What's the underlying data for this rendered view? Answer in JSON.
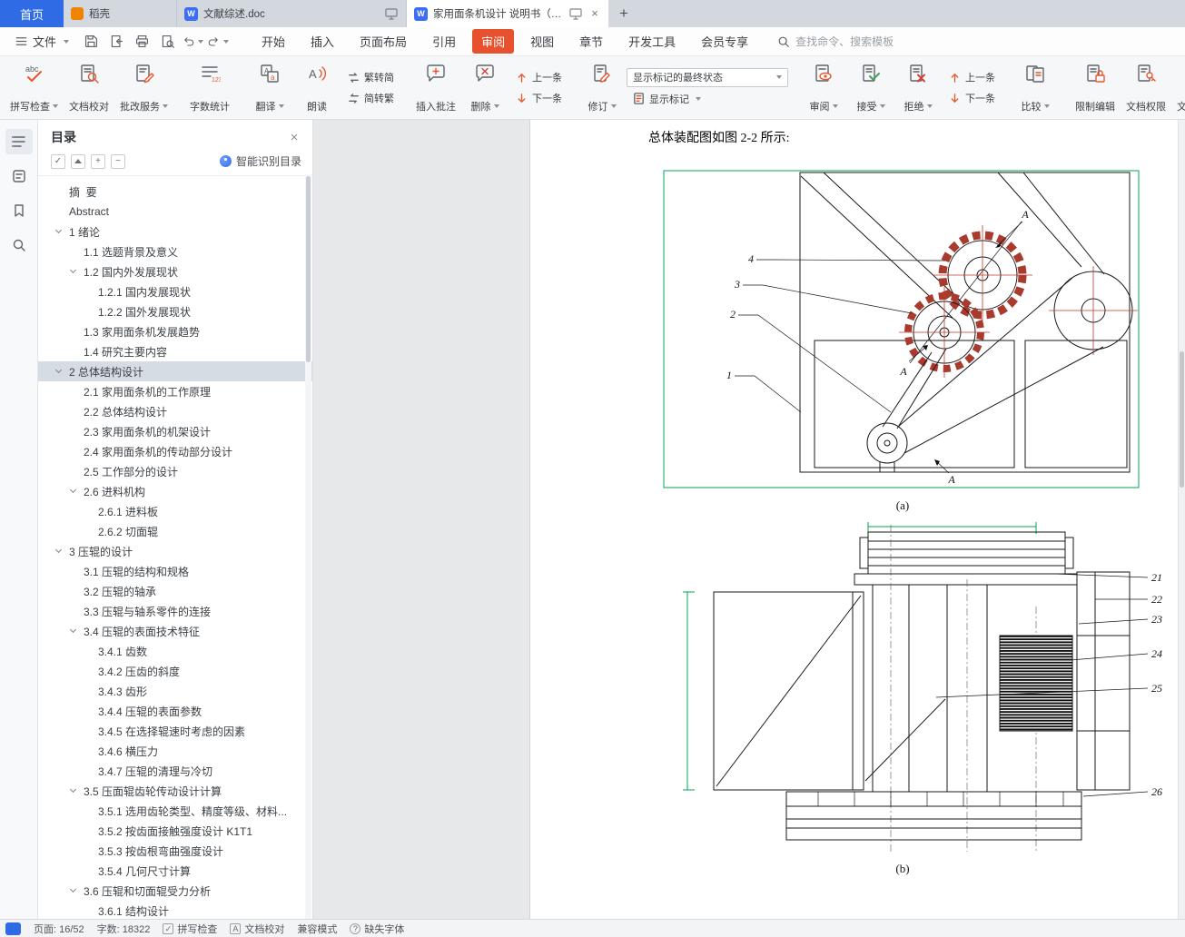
{
  "tabbar": {
    "home": "首页",
    "docer": "稻壳",
    "doc1": "文献综述.doc",
    "doc2": "家用面条机设计 说明书（论文）",
    "close": "×",
    "new_tab": "+"
  },
  "menubar": {
    "file": "文件",
    "items": [
      {
        "label": "开始"
      },
      {
        "label": "插入"
      },
      {
        "label": "页面布局"
      },
      {
        "label": "引用"
      },
      {
        "label": "审阅",
        "active": true
      },
      {
        "label": "视图"
      },
      {
        "label": "章节"
      },
      {
        "label": "开发工具"
      },
      {
        "label": "会员专享"
      }
    ],
    "search_placeholder": "查找命令、搜索模板"
  },
  "ribbon": {
    "spellcheck": "拼写检查",
    "proofread": "文档校对",
    "correction": "批改服务",
    "wordcount": "字数统计",
    "translate": "翻译",
    "readaloud": "朗读",
    "trad_to_simp": "繁转简",
    "simp_to_trad": "简转繁",
    "insert_comment": "插入批注",
    "delete_comment": "删除",
    "prev_comment": "上一条",
    "next_comment": "下一条",
    "track_changes": "修订",
    "markup_state": "显示标记的最终状态",
    "show_markup": "显示标记",
    "review": "审阅",
    "accept": "接受",
    "reject": "拒绝",
    "prev_change": "上一条",
    "next_change": "下一条",
    "compare": "比较",
    "restrict_edit": "限制编辑",
    "doc_permission": "文档权限",
    "doc_auth": "文档认证"
  },
  "toc": {
    "title": "目录",
    "close": "×",
    "smart_recognize": "智能识别目录",
    "items": [
      {
        "label": "摘  要",
        "level": 1
      },
      {
        "label": "Abstract",
        "level": 1
      },
      {
        "label": "1 绪论",
        "level": 1,
        "arrow": true
      },
      {
        "label": "1.1 选题背景及意义",
        "level": 2
      },
      {
        "label": "1.2 国内外发展现状",
        "level": 2,
        "arrow": true
      },
      {
        "label": "1.2.1 国内发展现状",
        "level": 3
      },
      {
        "label": "1.2.2 国外发展现状",
        "level": 3
      },
      {
        "label": "1.3 家用面条机发展趋势",
        "level": 2
      },
      {
        "label": "1.4 研究主要内容",
        "level": 2
      },
      {
        "label": "2 总体结构设计",
        "level": 1,
        "arrow": true,
        "selected": true
      },
      {
        "label": "2.1 家用面条机的工作原理",
        "level": 2
      },
      {
        "label": "2.2 总体结构设计",
        "level": 2
      },
      {
        "label": "2.3 家用面条机的机架设计",
        "level": 2
      },
      {
        "label": "2.4 家用面条机的传动部分设计",
        "level": 2
      },
      {
        "label": "2.5 工作部分的设计",
        "level": 2
      },
      {
        "label": "2.6 进料机构",
        "level": 2,
        "arrow": true
      },
      {
        "label": "2.6.1 进料板",
        "level": 3
      },
      {
        "label": "2.6.2 切面辊",
        "level": 3
      },
      {
        "label": "3 压辊的设计",
        "level": 1,
        "arrow": true
      },
      {
        "label": "3.1 压辊的结构和规格",
        "level": 2
      },
      {
        "label": "3.2 压辊的轴承",
        "level": 2
      },
      {
        "label": "3.3 压辊与轴系零件的连接",
        "level": 2
      },
      {
        "label": "3.4 压辊的表面技术特征",
        "level": 2,
        "arrow": true
      },
      {
        "label": "3.4.1 齿数",
        "level": 3
      },
      {
        "label": "3.4.2 压齿的斜度",
        "level": 3
      },
      {
        "label": "3.4.3 齿形",
        "level": 3
      },
      {
        "label": "3.4.4 压辊的表面参数",
        "level": 3
      },
      {
        "label": "3.4.5 在选择辊速时考虑的因素",
        "level": 3
      },
      {
        "label": "3.4.6 横压力",
        "level": 3
      },
      {
        "label": "3.4.7 压辊的清理与冷切",
        "level": 3
      },
      {
        "label": "3.5 压面辊齿轮传动设计计算",
        "level": 2,
        "arrow": true
      },
      {
        "label": "3.5.1 选用齿轮类型、精度等级、材料...",
        "level": 3
      },
      {
        "label": "3.5.2 按齿面接触强度设计 K1T1",
        "level": 3
      },
      {
        "label": "3.5.3 按齿根弯曲强度设计",
        "level": 3
      },
      {
        "label": "3.5.4 几何尺寸计算",
        "level": 3
      },
      {
        "label": "3.6 压辊和切面辊受力分析",
        "level": 2,
        "arrow": true
      },
      {
        "label": "3.6.1 结构设计",
        "level": 3
      }
    ]
  },
  "document": {
    "paragraph": "总体装配图如图 2-2 所示:",
    "figure_a": {
      "caption": "(a)",
      "parts": [
        "1",
        "2",
        "3",
        "4"
      ],
      "section_label": "A"
    },
    "figure_b": {
      "caption": "(b)",
      "parts": [
        "21",
        "22",
        "23",
        "24",
        "25",
        "26"
      ]
    }
  },
  "statusbar": {
    "page": "页面: 16/52",
    "words": "字数: 18322",
    "spellcheck": "拼写检查",
    "proofread": "文档校对",
    "compat_mode": "兼容模式",
    "missing_font": "缺失字体"
  }
}
